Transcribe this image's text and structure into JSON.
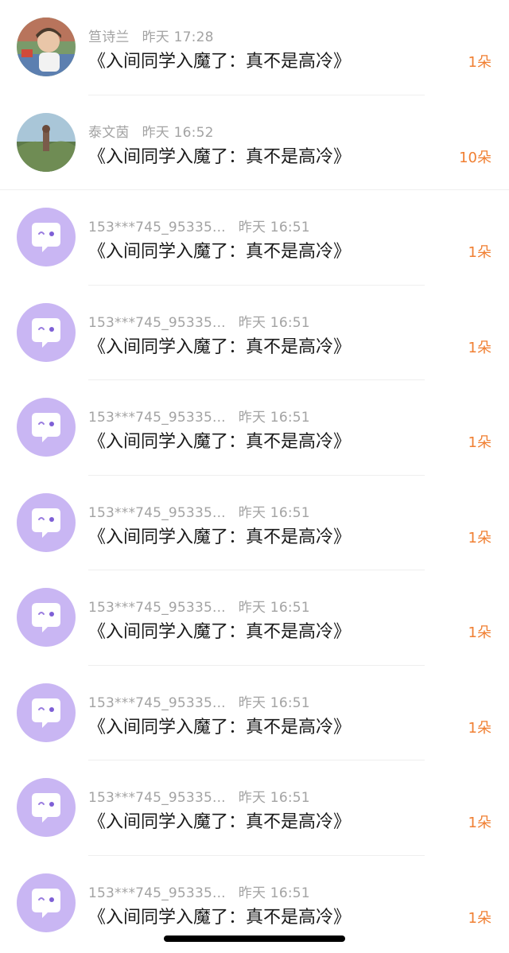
{
  "items": [
    {
      "name": "笪诗兰",
      "time": "昨天 17:28",
      "book": "《入间同学入魔了：真不是高冷》",
      "count": "1朵",
      "avatar": "photo-1"
    },
    {
      "name": "泰文茵",
      "time": "昨天 16:52",
      "book": "《入间同学入魔了：真不是高冷》",
      "count": "10朵",
      "avatar": "photo-2"
    },
    {
      "name": "153***745_95335...",
      "time": "昨天 16:51",
      "book": "《入间同学入魔了：真不是高冷》",
      "count": "1朵",
      "avatar": "default"
    },
    {
      "name": "153***745_95335...",
      "time": "昨天 16:51",
      "book": "《入间同学入魔了：真不是高冷》",
      "count": "1朵",
      "avatar": "default"
    },
    {
      "name": "153***745_95335...",
      "time": "昨天 16:51",
      "book": "《入间同学入魔了：真不是高冷》",
      "count": "1朵",
      "avatar": "default"
    },
    {
      "name": "153***745_95335...",
      "time": "昨天 16:51",
      "book": "《入间同学入魔了：真不是高冷》",
      "count": "1朵",
      "avatar": "default"
    },
    {
      "name": "153***745_95335...",
      "time": "昨天 16:51",
      "book": "《入间同学入魔了：真不是高冷》",
      "count": "1朵",
      "avatar": "default"
    },
    {
      "name": "153***745_95335...",
      "time": "昨天 16:51",
      "book": "《入间同学入魔了：真不是高冷》",
      "count": "1朵",
      "avatar": "default"
    },
    {
      "name": "153***745_95335...",
      "time": "昨天 16:51",
      "book": "《入间同学入魔了：真不是高冷》",
      "count": "1朵",
      "avatar": "default"
    },
    {
      "name": "153***745_95335...",
      "time": "昨天 16:51",
      "book": "《入间同学入魔了：真不是高冷》",
      "count": "1朵",
      "avatar": "default"
    }
  ],
  "colors": {
    "count": "#f07f32",
    "avatar_default": "#c9b6f3",
    "name": "#a3a3a3"
  }
}
